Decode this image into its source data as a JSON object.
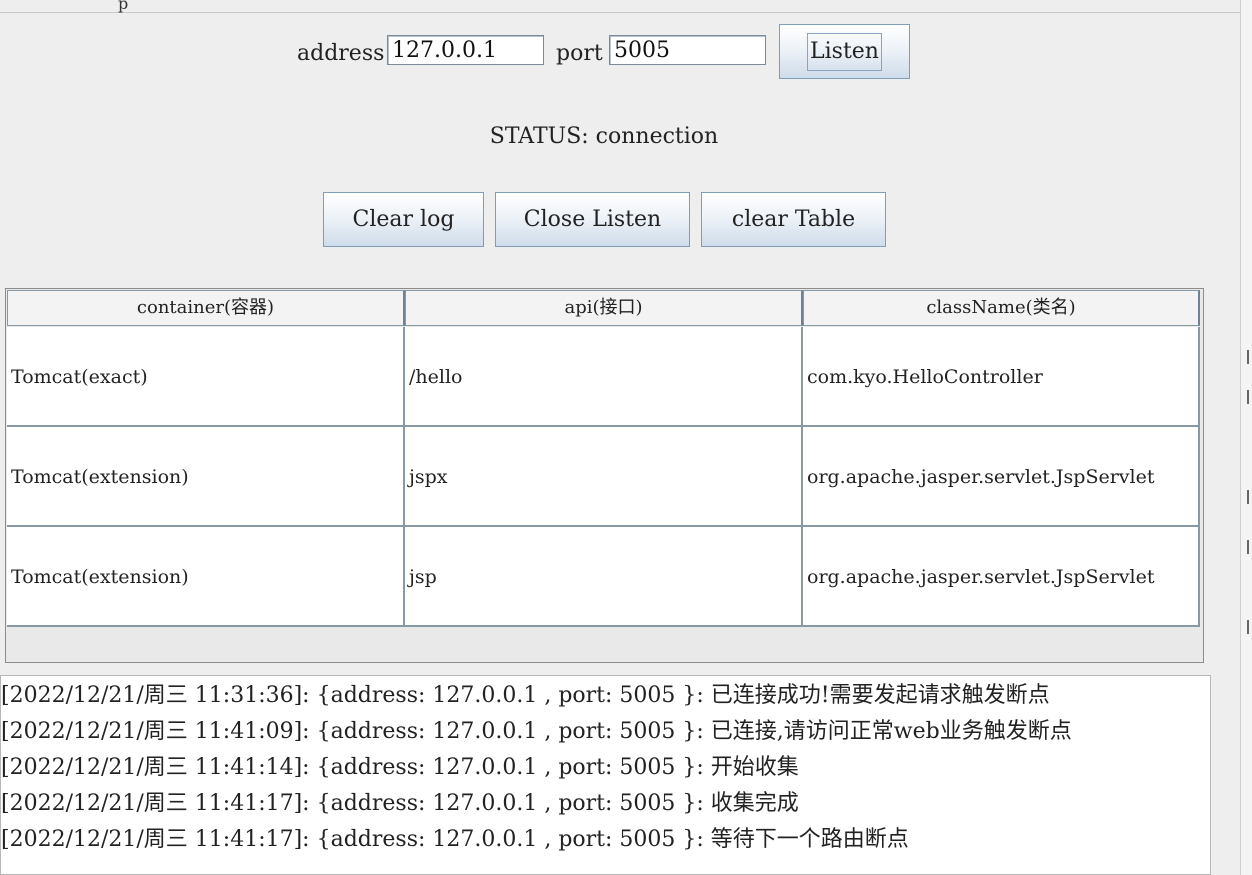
{
  "window": {
    "title_fragment": "p"
  },
  "form": {
    "address_label": "address",
    "address_value": "127.0.0.1",
    "port_label": "port",
    "port_value": "5005",
    "listen_label": "Listen"
  },
  "status_text": "STATUS: connection",
  "actions": {
    "clear_log": "Clear log",
    "close_listen": "Close Listen",
    "clear_table": "clear Table"
  },
  "table": {
    "columns": [
      "container(容器)",
      "api(接口)",
      "className(类名)"
    ],
    "rows": [
      [
        "Tomcat(exact)",
        "/hello",
        "com.kyo.HelloController"
      ],
      [
        "Tomcat(extension)",
        "jspx",
        "org.apache.jasper.servlet.JspServlet"
      ],
      [
        "Tomcat(extension)",
        "jsp",
        "org.apache.jasper.servlet.JspServlet"
      ]
    ]
  },
  "log": [
    "[2022/12/21/周三 11:31:36]: {address: 127.0.0.1 , port: 5005 }: 已连接成功!需要发起请求触发断点",
    "[2022/12/21/周三 11:41:09]: {address: 127.0.0.1 , port: 5005 }: 已连接,请访问正常web业务触发断点",
    "[2022/12/21/周三 11:41:14]: {address: 127.0.0.1 , port: 5005 }: 开始收集",
    "[2022/12/21/周三 11:41:17]: {address: 127.0.0.1 , port: 5005 }: 收集完成",
    "[2022/12/21/周三 11:41:17]: {address: 127.0.0.1 , port: 5005 }: 等待下一个路由断点"
  ]
}
